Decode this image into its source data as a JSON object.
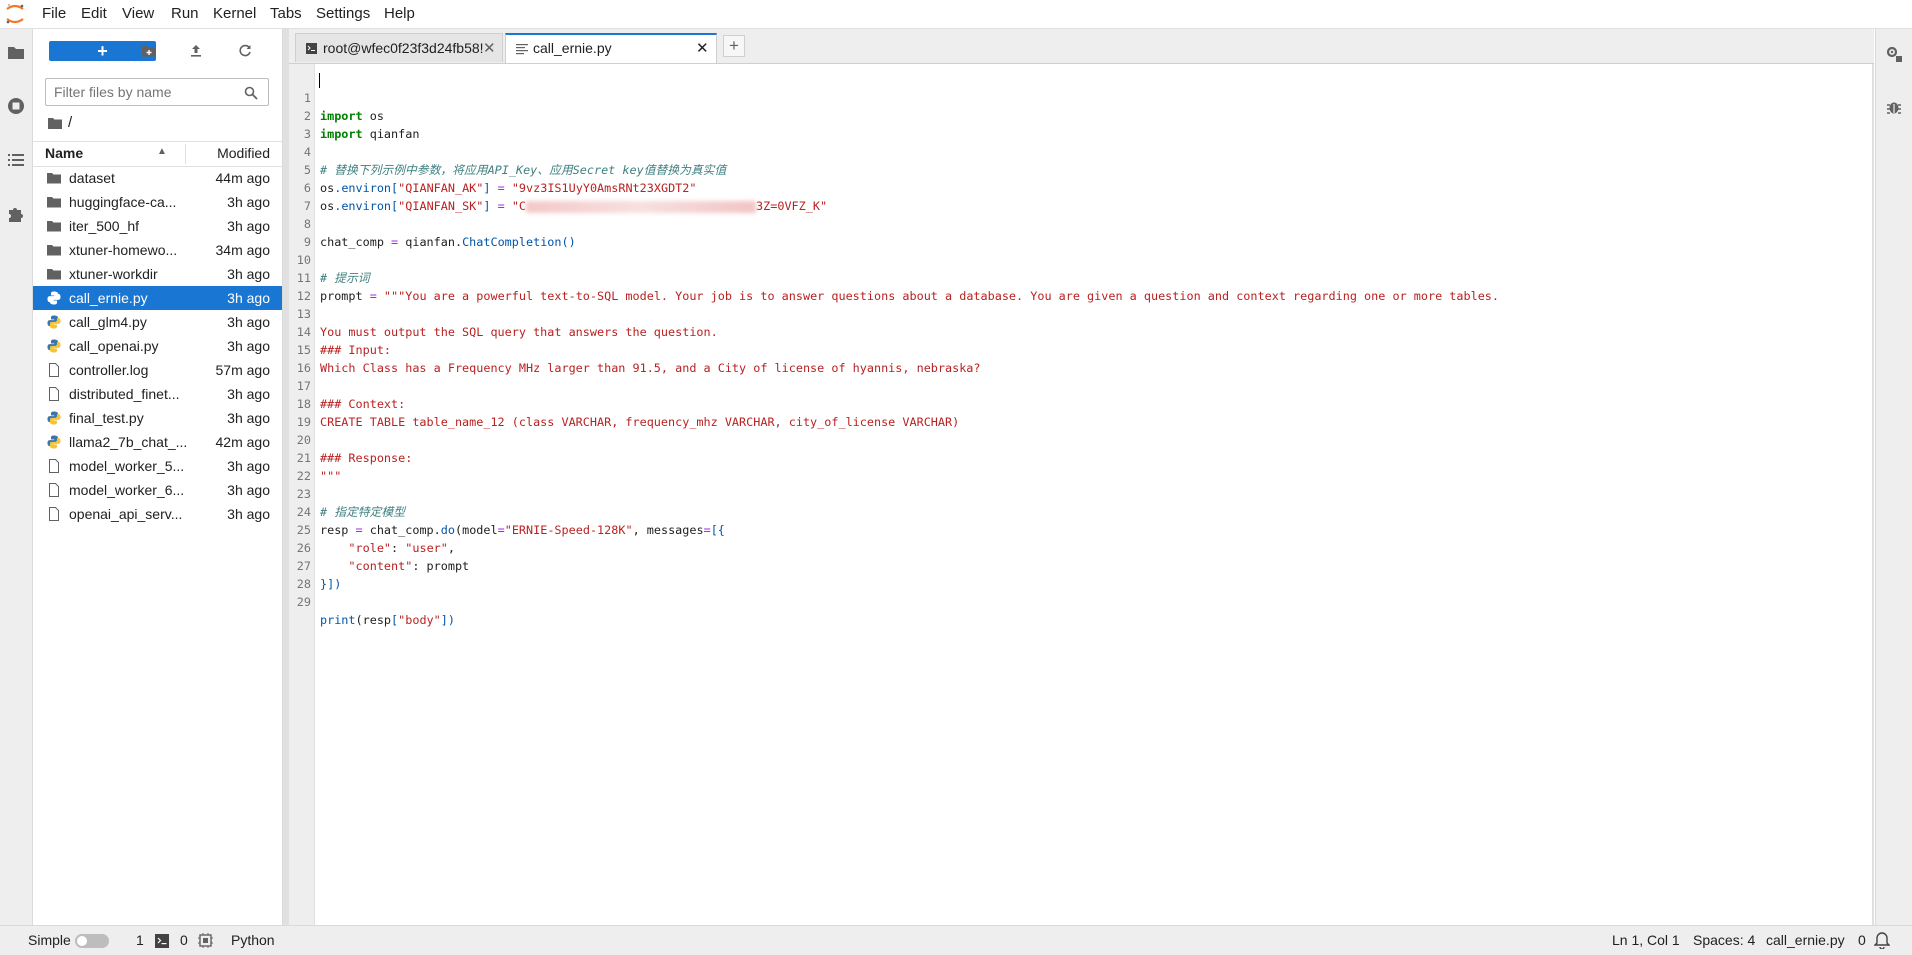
{
  "menubar": {
    "items": [
      "File",
      "Edit",
      "View",
      "Run",
      "Kernel",
      "Tabs",
      "Settings",
      "Help"
    ]
  },
  "filebrowser": {
    "new_label": "+",
    "search_placeholder": "Filter files by name",
    "breadcrumb": "/",
    "header": {
      "name": "Name",
      "modified": "Modified",
      "sort_indicator": "▲"
    },
    "files": [
      {
        "name": "dataset",
        "modified": "44m ago",
        "type": "folder"
      },
      {
        "name": "huggingface-ca...",
        "modified": "3h ago",
        "type": "folder"
      },
      {
        "name": "iter_500_hf",
        "modified": "3h ago",
        "type": "folder"
      },
      {
        "name": "xtuner-homewo...",
        "modified": "34m ago",
        "type": "folder"
      },
      {
        "name": "xtuner-workdir",
        "modified": "3h ago",
        "type": "folder"
      },
      {
        "name": "call_ernie.py",
        "modified": "3h ago",
        "type": "python",
        "selected": true
      },
      {
        "name": "call_glm4.py",
        "modified": "3h ago",
        "type": "python"
      },
      {
        "name": "call_openai.py",
        "modified": "3h ago",
        "type": "python"
      },
      {
        "name": "controller.log",
        "modified": "57m ago",
        "type": "file"
      },
      {
        "name": "distributed_finet...",
        "modified": "3h ago",
        "type": "file"
      },
      {
        "name": "final_test.py",
        "modified": "3h ago",
        "type": "python"
      },
      {
        "name": "llama2_7b_chat_...",
        "modified": "42m ago",
        "type": "python"
      },
      {
        "name": "model_worker_5...",
        "modified": "3h ago",
        "type": "file"
      },
      {
        "name": "model_worker_6...",
        "modified": "3h ago",
        "type": "file"
      },
      {
        "name": "openai_api_serv...",
        "modified": "3h ago",
        "type": "file"
      }
    ]
  },
  "tabs": [
    {
      "label": "root@wfec0f23f3d24fb58!",
      "active": false
    },
    {
      "label": "call_ernie.py",
      "active": true
    }
  ],
  "editor": {
    "line_numbers": [
      "1",
      "2",
      "3",
      "4",
      "5",
      "6",
      "7",
      "8",
      "9",
      "10",
      "11",
      "12",
      "13",
      "14",
      "15",
      "16",
      "17",
      "18",
      "19",
      "20",
      "21",
      "22",
      "23",
      "24",
      "25",
      "26",
      "27",
      "28",
      "29"
    ],
    "lines": {
      "l1_kw": "import",
      "l1_rest": " os",
      "l2_kw": "import",
      "l2_rest": " qianfan",
      "l4": "# 替换下列示例中参数，将应用API_Key、应用Secret key值替换为真实值",
      "l5_a": "os",
      "l5_b": ".environ",
      "l5_c": "[",
      "l5_d": "\"QIANFAN_AK\"",
      "l5_e": "]",
      "l5_f": " = ",
      "l5_g": "\"9vz3IS1UyY0AmsRNt23XGDT2\"",
      "l6_a": "os",
      "l6_b": ".environ",
      "l6_c": "[",
      "l6_d": "\"QIANFAN_SK\"",
      "l6_e": "]",
      "l6_f": " = ",
      "l6_g": "\"C",
      "l6_h": "3Z=0VFZ_K\"",
      "l8_a": "chat_comp ",
      "l8_b": "=",
      "l8_c": " qianfan.",
      "l8_d": "ChatCompletion",
      "l8_e": "()",
      "l10": "# 提示词",
      "l11_a": "prompt ",
      "l11_b": "=",
      "l11_c": " \"\"\"You are a powerful text-to-SQL model. Your job is to answer questions about a database. You are given a question and context regarding one or more tables.",
      "l13": "You must output the SQL query that answers the question.",
      "l14": "### Input:",
      "l15": "Which Class has a Frequency MHz larger than 91.5, and a City of license of hyannis, nebraska?",
      "l17": "### Context:",
      "l18": "CREATE TABLE table_name_12 (class VARCHAR, frequency_mhz VARCHAR, city_of_license VARCHAR)",
      "l20": "### Response:",
      "l21": "\"\"\"",
      "l23": "# 指定特定模型",
      "l24_a": "resp ",
      "l24_b": "=",
      "l24_c": " chat_comp.",
      "l24_d": "do",
      "l24_e": "(model",
      "l24_f": "=",
      "l24_g": "\"ERNIE-Speed-128K\"",
      "l24_h": ", messages",
      "l24_i": "=",
      "l24_j": "[{",
      "l25_a": "    ",
      "l25_b": "\"role\"",
      "l25_c": ": ",
      "l25_d": "\"user\"",
      "l25_e": ",",
      "l26_a": "    ",
      "l26_b": "\"content\"",
      "l26_c": ": prompt",
      "l27": "}])",
      "l29_a": "print",
      "l29_b": "(resp",
      "l29_c": "[",
      "l29_d": "\"body\"",
      "l29_e": "])"
    }
  },
  "statusbar": {
    "mode": "Simple",
    "terminals": "1",
    "kernels": "0",
    "language": "Python",
    "cursor": "Ln 1, Col 1",
    "spaces": "Spaces: 4",
    "filename": "call_ernie.py",
    "notifications": "0"
  },
  "colors": {
    "accent": "#1976d2",
    "keyword": "#008000",
    "string": "#ba2121",
    "comment": "#408080"
  }
}
